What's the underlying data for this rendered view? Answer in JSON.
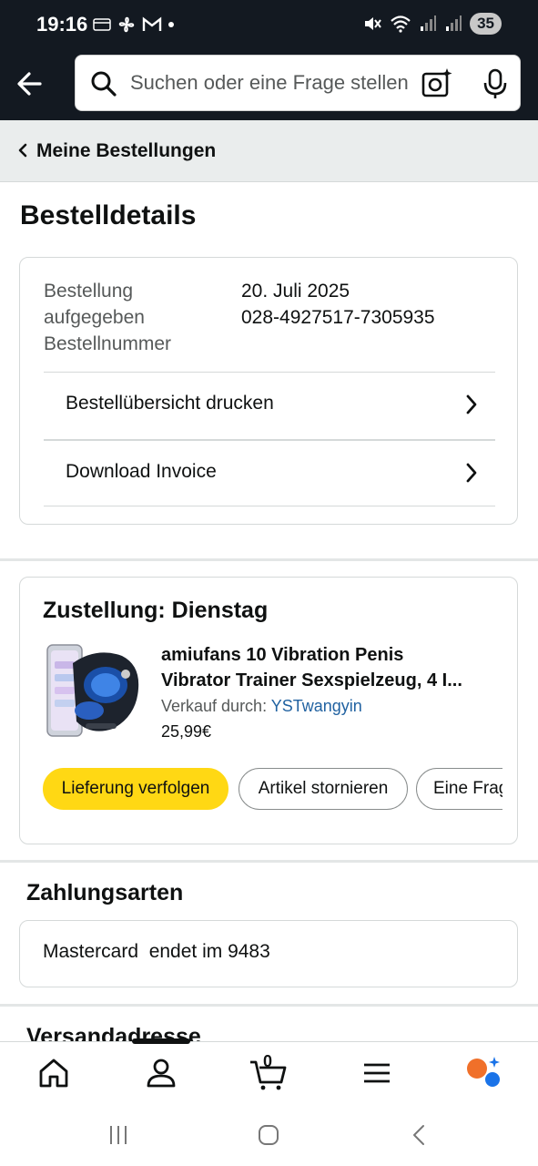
{
  "status_bar": {
    "time": "19:16",
    "battery": "35"
  },
  "search": {
    "placeholder": "Suchen oder eine Frage stellen"
  },
  "breadcrumb": {
    "label": "Meine Bestellungen"
  },
  "page": {
    "title": "Bestelldetails"
  },
  "order_details": {
    "date_label": "Bestellung aufgegeben",
    "date_value": "20. Juli 2025",
    "number_label": "Bestellnummer",
    "number_value": "028-4927517-7305935",
    "print_label": "Bestellübersicht drucken",
    "invoice_label": "Download Invoice"
  },
  "delivery": {
    "title": "Zustellung: Dienstag",
    "product_title_line1": "amiufans 10 Vibration Penis",
    "product_title_line2": "Vibrator Trainer Sexspielzeug, 4 I...",
    "seller_prefix": "Verkauf durch:",
    "seller_name": "YSTwangyin",
    "price": "25,99€",
    "buttons": {
      "track": "Lieferung verfolgen",
      "cancel": "Artikel stornieren",
      "question": "Eine Frag"
    }
  },
  "payment": {
    "title": "Zahlungsarten",
    "method": "Mastercard  endet im 9483"
  },
  "shipping": {
    "title": "Versandadresse"
  },
  "bottom_nav": {
    "cart_count": "0",
    "items": [
      "home-icon",
      "account-icon",
      "cart-icon",
      "menu-icon",
      "rufus-ai-icon"
    ]
  },
  "colors": {
    "header_bg": "#131921",
    "primary_button": "#ffd814",
    "link": "#2162a1",
    "rufus_orange": "#f0702a",
    "rufus_blue": "#1a73e8"
  }
}
